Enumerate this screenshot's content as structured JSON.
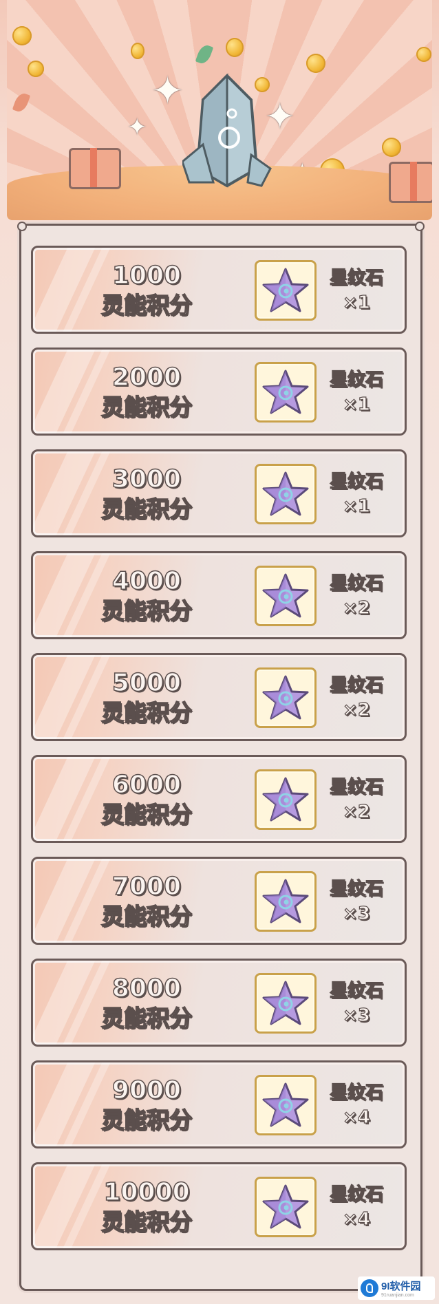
{
  "rewards": [
    {
      "points": "1000",
      "label": "灵能积分",
      "item_name": "星纹石",
      "item_qty": "×1"
    },
    {
      "points": "2000",
      "label": "灵能积分",
      "item_name": "星纹石",
      "item_qty": "×1"
    },
    {
      "points": "3000",
      "label": "灵能积分",
      "item_name": "星纹石",
      "item_qty": "×1"
    },
    {
      "points": "4000",
      "label": "灵能积分",
      "item_name": "星纹石",
      "item_qty": "×2"
    },
    {
      "points": "5000",
      "label": "灵能积分",
      "item_name": "星纹石",
      "item_qty": "×2"
    },
    {
      "points": "6000",
      "label": "灵能积分",
      "item_name": "星纹石",
      "item_qty": "×2"
    },
    {
      "points": "7000",
      "label": "灵能积分",
      "item_name": "星纹石",
      "item_qty": "×3"
    },
    {
      "points": "8000",
      "label": "灵能积分",
      "item_name": "星纹石",
      "item_qty": "×3"
    },
    {
      "points": "9000",
      "label": "灵能积分",
      "item_name": "星纹石",
      "item_qty": "×4"
    },
    {
      "points": "10000",
      "label": "灵能积分",
      "item_name": "星纹石",
      "item_qty": "×4"
    }
  ],
  "item_icon": "star-stone-icon",
  "watermark": {
    "brand": "9I软件园",
    "site": "91ruanjian.com"
  }
}
